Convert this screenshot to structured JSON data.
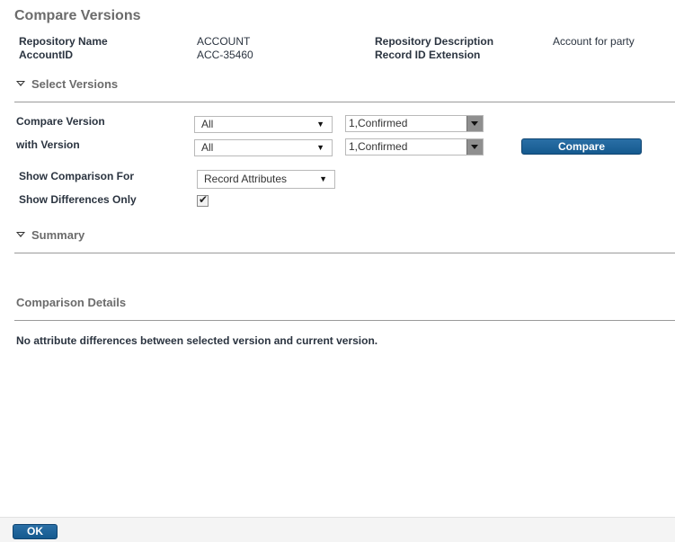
{
  "page": {
    "title": "Compare Versions"
  },
  "repository": {
    "name_label": "Repository Name",
    "name_value": "ACCOUNT",
    "account_id_label": "AccountID",
    "account_id_value": "ACC-35460",
    "description_label": "Repository Description",
    "description_value": "Account for party",
    "record_id_ext_label": "Record ID Extension"
  },
  "select_versions": {
    "heading": "Select Versions",
    "compare_version_label": "Compare Version",
    "with_version_label": "with Version",
    "compare_filter_value": "All",
    "with_filter_value": "All",
    "compare_version_value": "1,Confirmed",
    "with_version_value": "1,Confirmed",
    "compare_button": "Compare",
    "show_comparison_label": "Show Comparison For",
    "show_comparison_value": "Record Attributes",
    "differences_only_label": "Show Differences Only",
    "differences_only_checked": true
  },
  "summary": {
    "heading": "Summary"
  },
  "details": {
    "heading": "Comparison Details",
    "message": "No attribute differences between selected version and current version."
  },
  "footer": {
    "ok_button": "OK"
  }
}
